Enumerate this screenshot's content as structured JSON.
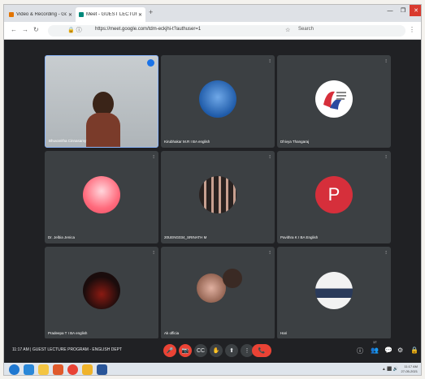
{
  "browser": {
    "tabs": [
      {
        "label": "Video & Recording - Google",
        "color": "#e37400"
      },
      {
        "label": "Meet - GUEST LECTURE PROG",
        "color": "#00897b"
      }
    ],
    "new_tab": "+",
    "window_controls": [
      "—",
      "❐",
      "✕"
    ],
    "url_prefix": "🔒 ⓘ",
    "url": "https://meet.google.com/tdm-eckjhi-t?authuser=1",
    "search_label": "Search"
  },
  "tiles": [
    {
      "name": "Bhuvanitha Cinnasamy",
      "type": "camera"
    },
    {
      "name": "Kirubhakar M.R I BA english",
      "type": "avatar",
      "avatar_color": "#1e5aa8"
    },
    {
      "name": "Dhivya Thangaraj",
      "type": "avatar",
      "avatar_color": "#ffffff"
    },
    {
      "name": "Dr. Jelbia Jenica",
      "type": "avatar",
      "avatar_color": "#ff6b7d"
    },
    {
      "name": "20UENG034_SRINATH M",
      "type": "avatar",
      "avatar_color": "#2a2220"
    },
    {
      "name": "Pavithra K I BA English",
      "type": "letter",
      "letter": "P",
      "avatar_color": "#d62f3b"
    },
    {
      "name": "Pradeepa T I BA english",
      "type": "avatar",
      "avatar_color": "#1a0c0c"
    },
    {
      "name": "Ak officia",
      "type": "avatar",
      "avatar_color": "#8a5a48"
    },
    {
      "name": "Hari",
      "type": "avatar",
      "avatar_color": "#f2f2f2"
    }
  ],
  "meeting": {
    "time": "11:17 AM",
    "title": "GUEST LECTURE PROGRAM - ENGLISH DEPT",
    "separator": "|",
    "people_count": "17"
  },
  "controls": {
    "mic": "🎤",
    "camera": "📷",
    "captions": "CC",
    "raise_hand": "✋",
    "present": "⬆",
    "more": "⋮",
    "leave": "📞",
    "info": "ⓘ",
    "people": "👥",
    "chat": "💬",
    "activities": "⚙",
    "lock": "🔒"
  },
  "taskbar": {
    "tray": "▲ ⬛ 🔊",
    "time": "11:17 AM",
    "date": "27-05-2021",
    "apps": [
      {
        "name": "windows",
        "color": "#1f78d1"
      },
      {
        "name": "ie",
        "color": "#2b88d8"
      },
      {
        "name": "explorer",
        "color": "#f4c542"
      },
      {
        "name": "media",
        "color": "#e05a2b"
      },
      {
        "name": "chrome",
        "color": "#e94335"
      },
      {
        "name": "folder",
        "color": "#f0b32a"
      },
      {
        "name": "word",
        "color": "#2a5699"
      }
    ]
  }
}
